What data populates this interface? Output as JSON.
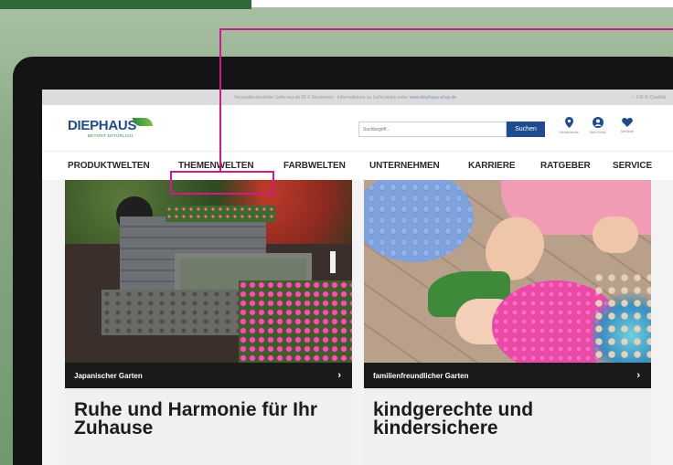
{
  "colors": {
    "brand_blue": "#1f4c8f",
    "highlight_pink": "#d11a8a",
    "background_green": "#7f9f7a"
  },
  "info_bar": {
    "left_text": "Versandkostenfreie Lieferung ab 99 € Warenwert · Informationen zu Lieferzeiten unter",
    "link_text": "www.diephaus-shop.de",
    "right_text": "✓ 100 % Qualität"
  },
  "header": {
    "logo_text": "DIEPHAUS",
    "logo_tagline": "BETONT NATÜRLICH.",
    "search_placeholder": "Suchbegriff...",
    "search_button": "Suchen",
    "icons": [
      {
        "name": "location-icon",
        "glyph": "⬤",
        "label": "Händlersuche"
      },
      {
        "name": "account-icon",
        "glyph": "●",
        "label": "Mein Konto"
      },
      {
        "name": "heart-icon",
        "glyph": "♥",
        "label": "Merkliste"
      }
    ]
  },
  "nav": {
    "items": [
      "PRODUKTWELTEN",
      "THEMENWELTEN",
      "FARBWELTEN",
      "UNTERNEHMEN",
      "KARRIERE",
      "RATGEBER",
      "SERVICE"
    ],
    "highlighted": "THEMENWELTEN"
  },
  "tiles": [
    {
      "category": "Japanischer Garten",
      "title": "Ruhe und Harmonie für Ihr Zuhause",
      "chevron": "›"
    },
    {
      "category": "familienfreundlicher Garten",
      "title": "kindgerechte und kindersichere",
      "chevron": "›"
    }
  ]
}
